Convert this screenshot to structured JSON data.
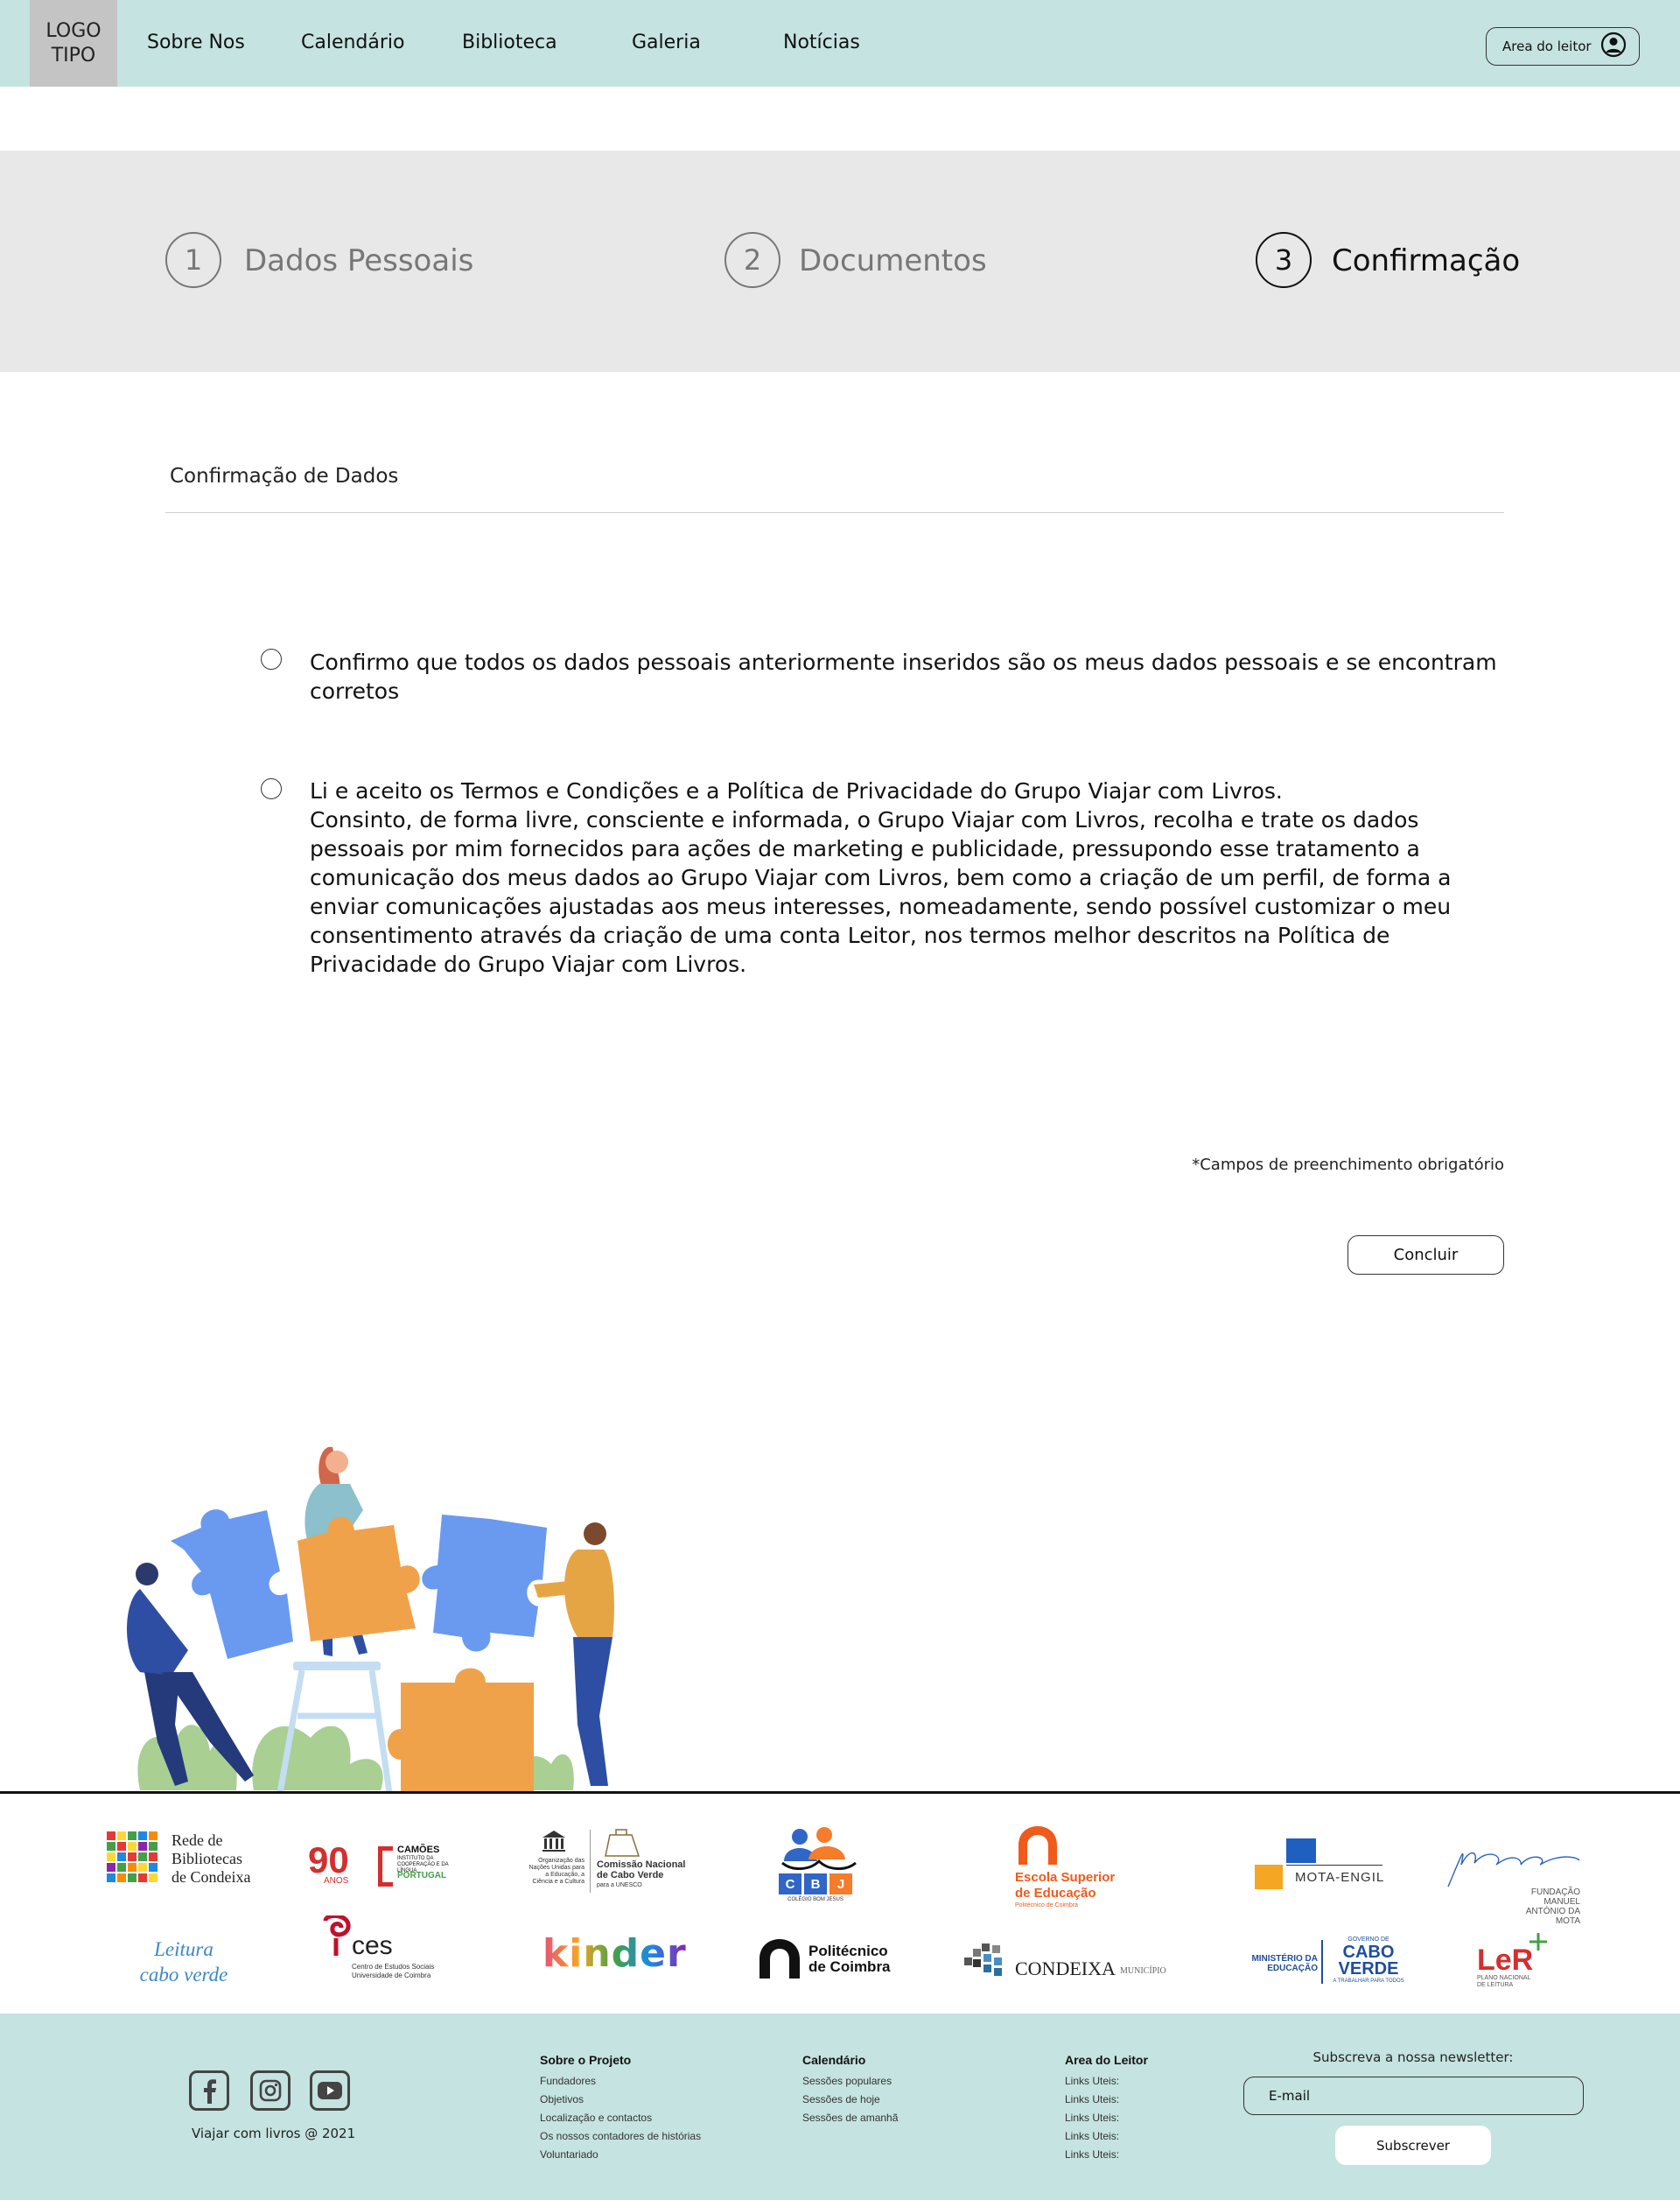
{
  "header": {
    "logo_text": "LOGO\nTIPO",
    "nav": [
      "Sobre Nos",
      "Calendário",
      "Biblioteca",
      "Galeria",
      "Notícias"
    ],
    "reader_button": "Area do leitor",
    "reader_icon": "user-circle-icon"
  },
  "steps": [
    {
      "number": "1",
      "label": "Dados Pessoais",
      "active": false
    },
    {
      "number": "2",
      "label": "Documentos",
      "active": false
    },
    {
      "number": "3",
      "label": "Confirmação",
      "active": true
    }
  ],
  "form": {
    "section_title": "Confirmação de Dados",
    "option1": "Confirmo que todos os dados pessoais anteriormente inseridos são os meus dados pessoais e se encontram corretos",
    "option2_line1": "Li e aceito os Termos e Condições e a Política de Privacidade do Grupo Viajar com Livros.",
    "option2_line2": "Consinto, de forma livre, consciente e informada, o Grupo Viajar com Livros, recolha e trate os dados pessoais por mim fornecidos para ações de marketing e publicidade, pressupondo esse tratamento a comunicação dos meus dados ao Grupo Viajar com Livros, bem como a criação de um perfil, de forma a enviar comunicações ajustadas aos meus interesses, nomeadamente, sendo possível customizar o meu consentimento através da criação de uma conta Leitor, nos termos melhor descritos na Política de Privacidade do Grupo Viajar com Livros.",
    "required_note": "*Campos de preenchimento obrigatório",
    "submit_label": "Concluir"
  },
  "partners": {
    "rede_bibliotecas": "Rede de\nBibliotecas\nde Condeixa",
    "camoes_years": "90",
    "camoes_anos": "ANOS",
    "camoes_name": "CAMÕES",
    "camoes_sub": "INSTITUTO DA COOPERAÇÃO E DA LÍNGUA",
    "camoes_country": "PORTUGAL",
    "unesco_left": "Organização das Nações Unidas para a Educação, a Ciência e a Cultura",
    "unesco_right": "Comissão Nacional de Cabo Verde",
    "unesco_right_sub": "para a UNESCO",
    "cbj": [
      "C",
      "B",
      "J"
    ],
    "cbj_sub": "COLÉGIO BOM JESUS",
    "escola_name": "Escola Superior\nde Educação",
    "escola_sub": "Politécnico de Coimbra",
    "mota_engil": "MOTA-ENGIL",
    "fundacao": "FUNDAÇÃO MANUEL\nANTÓNIO DA MOTA",
    "leitura": "Leitura\ncabo verde",
    "ces_name": "ces",
    "ces_sub": "Centro de Estudos Sociais\nUniversidade de Coimbra",
    "kinder": "kinder",
    "politecnico": "Politécnico\nde Coimbra",
    "condeixa": "CONDEIXA",
    "condeixa_sub": "MUNICÍPIO",
    "ministerio": "MINISTÉRIO DA\nEDUCAÇÃO",
    "gov_top": "GOVERNO DE",
    "gov_cabo": "CABO",
    "gov_verde": "VERDE",
    "gov_sub": "A TRABALHAR PARA TODOS",
    "ler": "LeR",
    "ler_sub": "PLANO NACIONAL\nDE LEITURA"
  },
  "footer": {
    "social_icons": [
      "facebook-icon",
      "instagram-icon",
      "youtube-icon"
    ],
    "copyright": "Viajar com livros @ 2021",
    "columns": [
      {
        "title": "Sobre o Projeto",
        "links": [
          "Fundadores",
          "Objetivos",
          "Localização e contactos",
          "Os nossos contadores de histórias",
          "Voluntariado"
        ]
      },
      {
        "title": "Calendário",
        "links": [
          "Sessões populares",
          "Sessões de hoje",
          "Sessões de amanhã"
        ]
      },
      {
        "title": "Area do Leitor",
        "links": [
          "Links Uteis:",
          "Links Uteis:",
          "Links Uteis:",
          "Links Uteis:",
          "Links Uteis:"
        ]
      }
    ],
    "newsletter_title": "Subscreva a nossa newsletter:",
    "email_placeholder": "E-mail",
    "subscribe_label": "Subscrever"
  },
  "colors": {
    "header_bg": "#c5e3e0",
    "steps_bg": "#e8e8e8",
    "footer_bg": "#c5e3e0",
    "puzzle_blue": "#6a9af0",
    "puzzle_orange": "#f0a24a"
  }
}
